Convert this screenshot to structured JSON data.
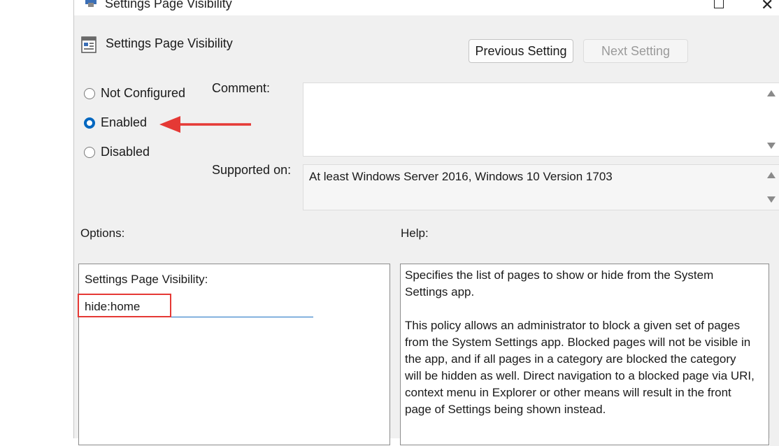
{
  "window": {
    "title": "Settings Page Visibility"
  },
  "header": {
    "policy_title": "Settings Page Visibility"
  },
  "nav": {
    "previous_label": "Previous Setting",
    "next_label": "Next Setting"
  },
  "state": {
    "options": [
      {
        "label": "Not Configured",
        "checked": false
      },
      {
        "label": "Enabled",
        "checked": true
      },
      {
        "label": "Disabled",
        "checked": false
      }
    ]
  },
  "fields": {
    "comment_label": "Comment:",
    "comment_value": "",
    "supported_label": "Supported on:",
    "supported_value": "At least Windows Server 2016, Windows 10 Version 1703"
  },
  "sections": {
    "options_heading": "Options:",
    "help_heading": "Help:"
  },
  "options_panel": {
    "field_label": "Settings Page Visibility:",
    "field_value": "hide:home"
  },
  "help_panel": {
    "paragraphs": [
      "Specifies the list of pages to show or hide from the System Settings app.",
      "This policy allows an administrator to block a given set of pages from the System Settings app. Blocked pages will not be visible in the app, and if all pages in a category are blocked the category will be hidden as well. Direct navigation to a blocked page via URI, context menu in Explorer or other means will result in the front page of Settings being shown instead."
    ]
  },
  "colors": {
    "accent": "#0067c0",
    "annotation_red": "#e53935",
    "window_bg": "#f0f0f0"
  },
  "icons": [
    "app-icon",
    "policy-icon",
    "maximize-icon",
    "close-icon",
    "annotation-arrow-icon"
  ]
}
